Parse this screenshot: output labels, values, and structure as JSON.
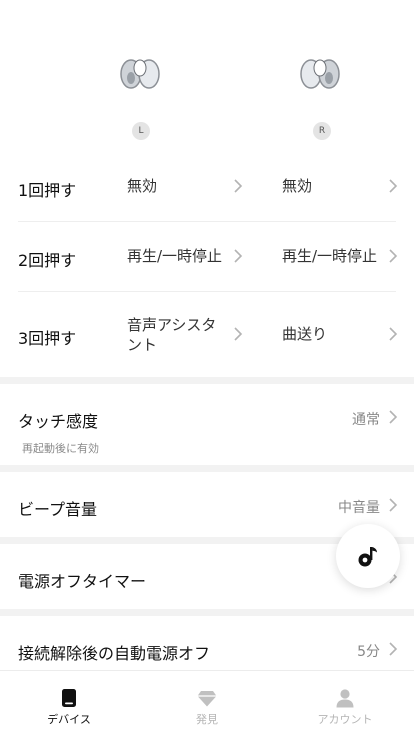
{
  "earbuds": {
    "left_badge": "L",
    "right_badge": "R"
  },
  "controls": [
    {
      "label": "1回押す",
      "left": "無効",
      "right": "無効"
    },
    {
      "label": "2回押す",
      "left": "再生/一時停止",
      "right": "再生/一時停止"
    },
    {
      "label": "3回押す",
      "left": "音声アシスタント",
      "right": "曲送り"
    }
  ],
  "settings": {
    "touch": {
      "label": "タッチ感度",
      "sub": "再起動後に有効",
      "value": "通常"
    },
    "beep": {
      "label": "ビープ音量",
      "value": "中音量"
    },
    "timer": {
      "label": "電源オフタイマー"
    },
    "auto_off": {
      "label": "接続解除後の自動電源オフ",
      "value": "5分"
    }
  },
  "nav": {
    "device": "デバイス",
    "discover": "発見",
    "account": "アカウント"
  },
  "colors": {
    "active": "#111111",
    "inactive": "#b5b5b5",
    "chevron": "#b3b3b3"
  }
}
